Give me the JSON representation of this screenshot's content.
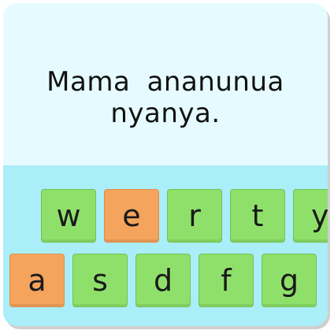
{
  "prompt": {
    "sentence": "Mama ananunua nyanya."
  },
  "keyboard": {
    "row1": [
      {
        "label": "w",
        "highlighted": false
      },
      {
        "label": "e",
        "highlighted": true
      },
      {
        "label": "r",
        "highlighted": false
      },
      {
        "label": "t",
        "highlighted": false
      },
      {
        "label": "y",
        "highlighted": false
      }
    ],
    "row2": [
      {
        "label": "a",
        "highlighted": true
      },
      {
        "label": "s",
        "highlighted": false
      },
      {
        "label": "d",
        "highlighted": false
      },
      {
        "label": "f",
        "highlighted": false
      },
      {
        "label": "g",
        "highlighted": false
      }
    ]
  },
  "colors": {
    "key": "#8fe06a",
    "key_highlight": "#f4a45d",
    "keyboard_bg": "#a9eef9",
    "prompt_bg": "#e6fbff"
  }
}
